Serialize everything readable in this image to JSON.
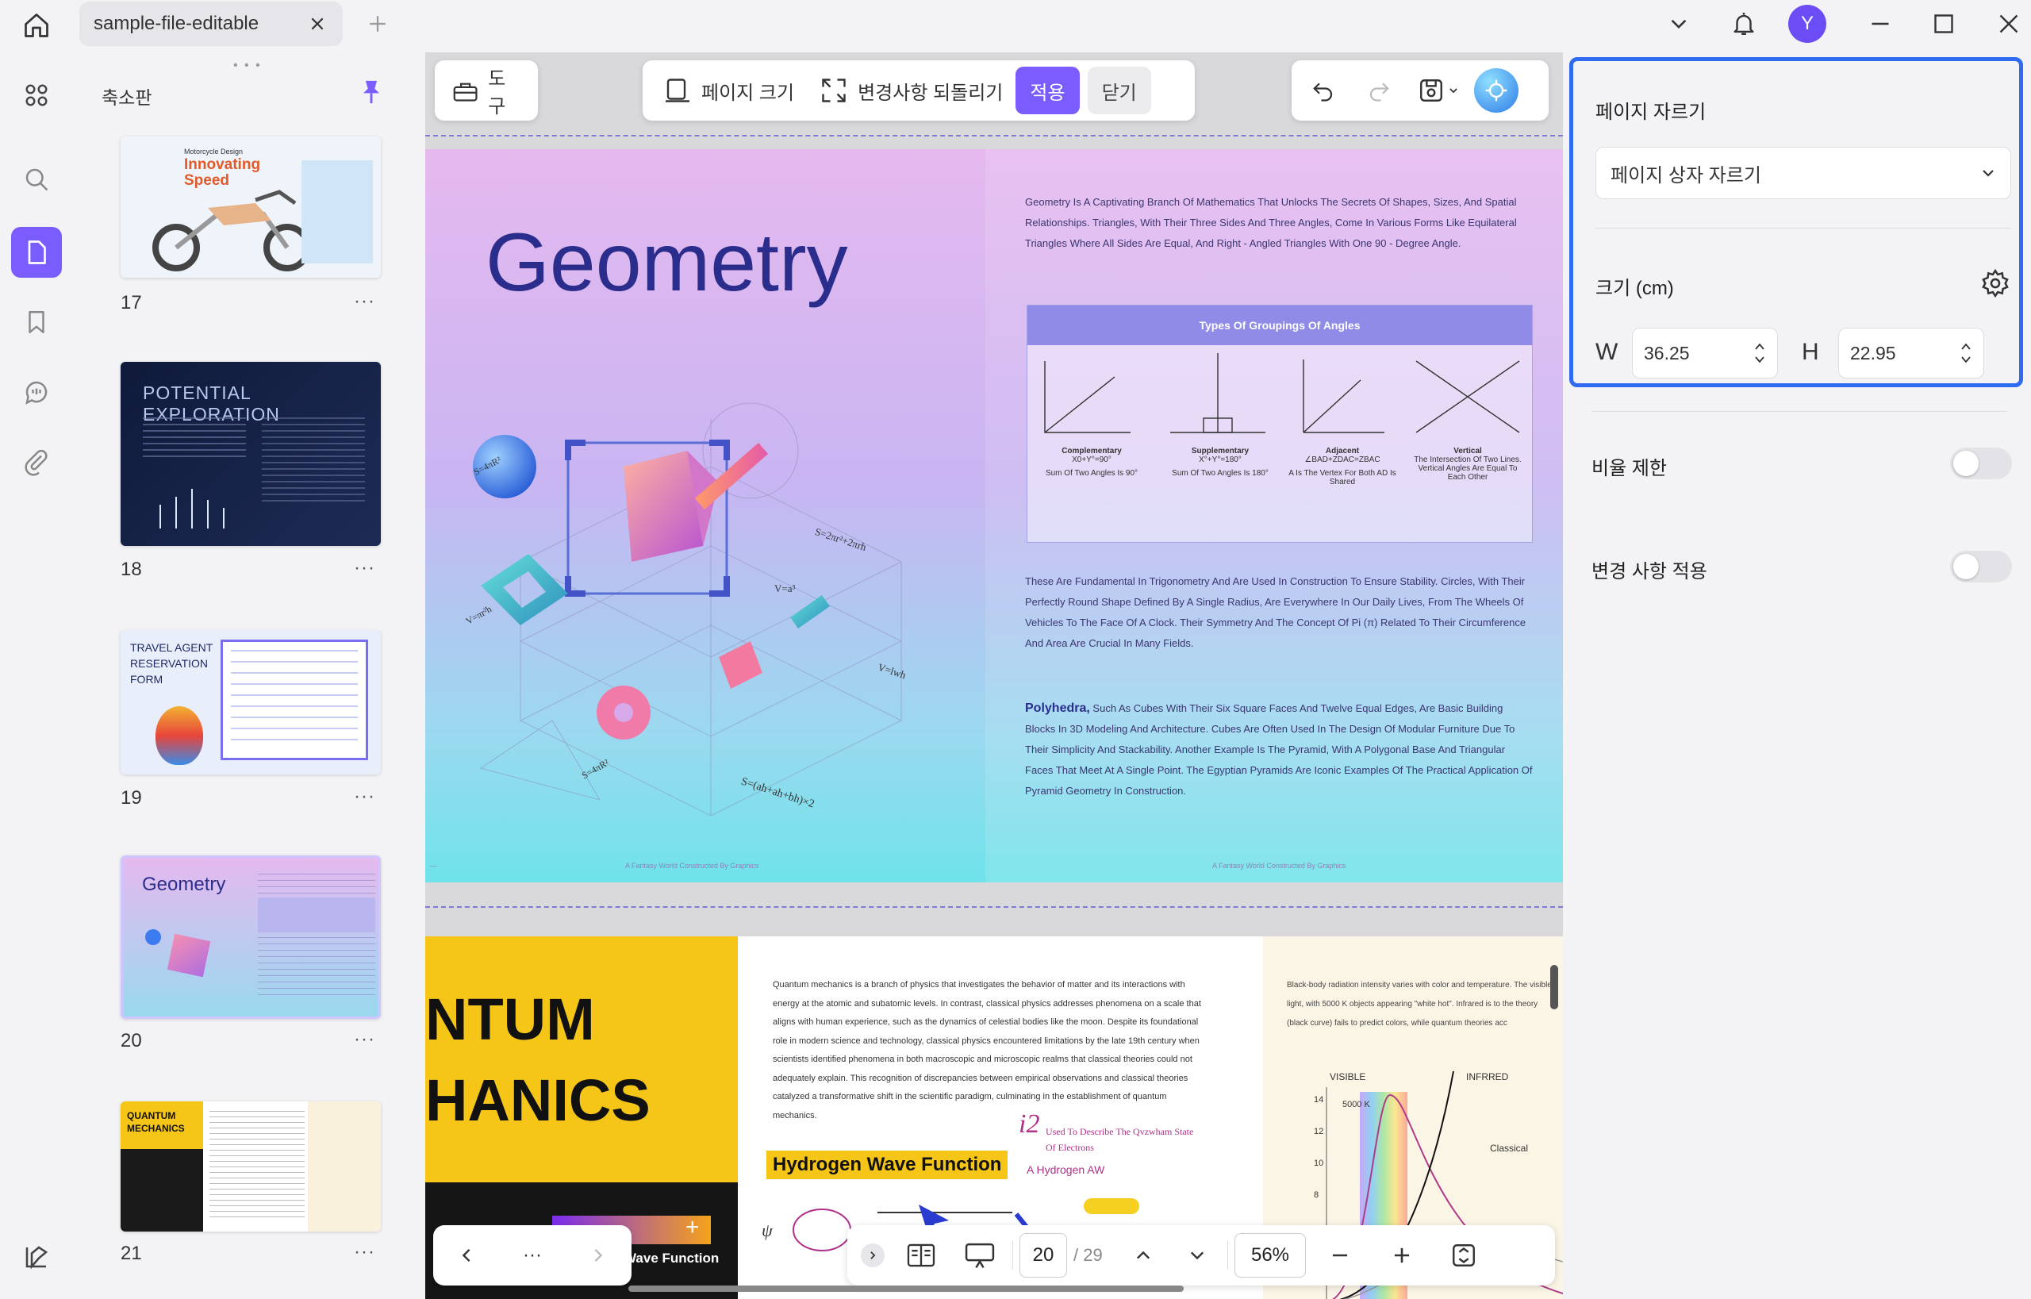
{
  "tab": {
    "title": "sample-file-editable"
  },
  "thumbnails": {
    "title": "축소판",
    "pages": [
      {
        "num": "17",
        "more": "···",
        "heading": "Innovating Speed",
        "subheading": "Motorcycle Design"
      },
      {
        "num": "18",
        "more": "···",
        "heading": "POTENTIAL EXPLORATION"
      },
      {
        "num": "19",
        "more": "···",
        "heading": "TRAVEL AGENT RESERVATION FORM"
      },
      {
        "num": "20",
        "more": "···",
        "heading": "Geometry"
      },
      {
        "num": "21",
        "more": "···",
        "heading": "QUANTUM MECHANICS"
      }
    ]
  },
  "toolbar": {
    "tools": "도구",
    "page_size": "페이지 크기",
    "revert": "변경사항 되돌리기",
    "apply": "적용",
    "close": "닫기"
  },
  "doc": {
    "geometry_title": "Geometry",
    "para1": "Geometry Is A Captivating Branch Of Mathematics That Unlocks The Secrets Of Shapes, Sizes, And Spatial Relationships. Triangles, With Their Three Sides And Three Angles, Come In Various Forms Like Equilateral Triangles Where All Sides Are Equal, And Right - Angled Triangles With One 90 - Degree Angle.",
    "angles_heading": "Types Of Groupings Of Angles",
    "angles": [
      {
        "name": "Complementary",
        "formula": "X0+Y°=90°",
        "desc": "Sum Of Two Angles Is 90°"
      },
      {
        "name": "Supplementary",
        "formula": "X°+Y°=180°",
        "desc": "Sum Of Two Angles Is 180°"
      },
      {
        "name": "Adjacent",
        "formula": "∠BAD+ZDAC=ZBAC",
        "desc": "A Is The Vertex For Both AD Is Shared"
      },
      {
        "name": "Vertical",
        "formula": "",
        "desc": "The Intersection Of Two Lines. Vertical Angles Are Equal To Each Other"
      }
    ],
    "para2": "These Are Fundamental In Trigonometry And Are Used In Construction To Ensure Stability. Circles, With Their Perfectly Round Shape Defined By A Single Radius, Are Everywhere In Our Daily Lives, From The Wheels Of Vehicles To The Face Of A Clock. Their Symmetry And The Concept Of Pi (π) Related To Their Circumference And Area Are Crucial In Many Fields.",
    "polyhedra_word": "Polyhedra,",
    "para3": " Such As Cubes With Their Six Square Faces And Twelve Equal Edges, Are Basic Building Blocks In 3D Modeling And Architecture. Cubes Are Often Used In The Design Of Modular Furniture Due To Their Simplicity And Stackability. Another Example Is The Pyramid, With A Polygonal Base And Triangular Faces That Meet At A Single Point. The Egyptian Pyramids Are Iconic Examples Of The Practical Application Of Pyramid Geometry In Construction.",
    "footer_center": "A Fantasy World Constructed By Graphics",
    "formulas": [
      "S=4πR²",
      "S=2πr²+2πrh",
      "V=a³",
      "V=lwh",
      "V=πr²h",
      "S=4πR²",
      "S=(ah+ah+bh)×2"
    ],
    "quantum_line1": "NTUM",
    "quantum_line2": "HANICS",
    "quantum_text": "Quantum mechanics is a branch of physics that investigates the behavior of matter and its interactions with energy at the atomic and subatomic levels. In contrast, classical physics addresses phenomena on a scale that aligns with human experience, such as the dynamics of celestial bodies like the moon. Despite its foundational role in modern science and technology, classical physics encountered limitations by the late 19th century when scientists identified phenomena in both macroscopic and microscopic realms that classical theories could not adequately explain. This recognition of discrepancies between empirical observations and classical theories catalyzed a transformative shift in the scientific paradigm, culminating in the establishment of quantum mechanics.",
    "hydrogen_label": "Hydrogen Wave Function",
    "i2_note": "i2",
    "i2_caption": "Used To Describe The Qvzwham State Of Electrons",
    "hydrogen_aw": "A Hydrogen AW",
    "wave_function_tag": "Wave Function",
    "blackbody_text": "Black-body radiation intensity varies with color and temperature. The visible light, with 5000 K objects appearing \"white hot\". Infrared is to the theory (black curve) fails to predict colors, while quantum theories acc",
    "visible_label": "VISIBLE",
    "infrared_label": "INFRRED",
    "k5000": "5000 K",
    "classical_label": "Classical",
    "y_ticks": [
      "14",
      "12",
      "10",
      "8"
    ]
  },
  "bottom_nav": {
    "more": "···",
    "current_page": "20",
    "total_pages": "/ 29",
    "zoom": "56%"
  },
  "right_panel": {
    "crop_title": "페이지 자르기",
    "crop_mode": "페이지 상자 자르기",
    "size_label": "크기 (cm)",
    "w_label": "W",
    "w_value": "36.25",
    "h_label": "H",
    "h_value": "22.95",
    "ratio_lock": "비율 제한",
    "apply_changes": "변경 사항 적용"
  },
  "colors": {
    "accent": "#7a5cff",
    "highlight_border": "#2f6bf0",
    "avatar": "#6c4cf5"
  },
  "avatar_initial": "Y"
}
